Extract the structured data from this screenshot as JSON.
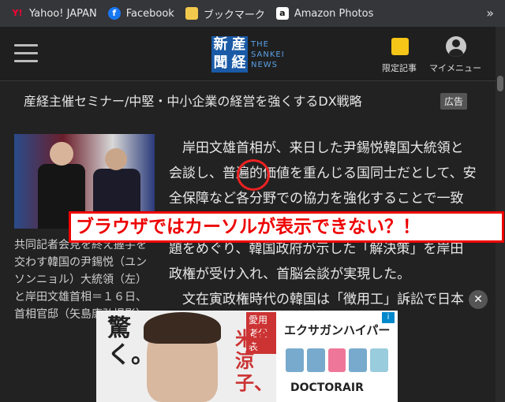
{
  "bookmarks": [
    {
      "label": "Yahoo! JAPAN",
      "icon": "yahoo-icon",
      "icon_char": "Y!",
      "color": "#ff0033"
    },
    {
      "label": "Facebook",
      "icon": "facebook-icon",
      "icon_char": "f",
      "color": "#1877f2"
    },
    {
      "label": "ブックマーク",
      "icon": "folder-icon",
      "icon_char": "",
      "color": "#f2c94c"
    },
    {
      "label": "Amazon Photos",
      "icon": "amazon-icon",
      "icon_char": "a",
      "color": "#ffffff"
    }
  ],
  "bookmarks_more": "»",
  "header": {
    "logo_kanji": [
      "新",
      "産",
      "聞",
      "経"
    ],
    "logo_en": [
      "THE",
      "SANKEI",
      "NEWS"
    ],
    "members_label": "限定記事",
    "menu_label": "マイメニュー"
  },
  "promo": {
    "text": "産経主催セミナー/中堅・中小企業の経営を強くするDX戦略",
    "badge": "広告"
  },
  "caption": "共同記者会見を終え握手を交わす韓国の尹錫悦（ユンソンニョル）大統領（左）と岸田文雄首相＝１６日、首相官邸（矢島康弘撮影）",
  "article": {
    "p1": "岸田文雄首相が、来日した尹錫悦韓国大統領と会談し、普遍的価値を重んじる国同士だとして、安全保障など各分野での協力を強化することで一致した。",
    "p2": "題をめぐり、韓国政府が示した「解決策」を岸田政権が受け入れ、首脳会談が実現した。",
    "p3": "文在寅政権時代の韓国は「徴用工」訴訟で日本企業に賠償を命じ、日韓関係は戦後"
  },
  "banner": "ブラウザではカーソルが表示できない？！",
  "ad": {
    "big_text": "驚く。",
    "tag": "愛用者代表",
    "name": "米倉涼子、",
    "brand": "エクサガンハイパー",
    "logo": "DOCTORAIR",
    "close": "✕"
  }
}
